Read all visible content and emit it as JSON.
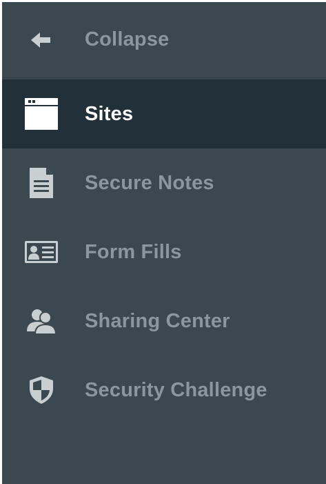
{
  "sidebar": {
    "collapse": {
      "label": "Collapse",
      "icon": "arrow-left-icon"
    },
    "items": [
      {
        "label": "Sites",
        "icon": "browser-window-icon",
        "active": true
      },
      {
        "label": "Secure Notes",
        "icon": "document-icon",
        "active": false
      },
      {
        "label": "Form Fills",
        "icon": "id-card-icon",
        "active": false
      },
      {
        "label": "Sharing Center",
        "icon": "users-icon",
        "active": false
      },
      {
        "label": "Security Challenge",
        "icon": "shield-icon",
        "active": false
      }
    ]
  },
  "colors": {
    "sidebar_bg": "#3c4850",
    "active_bg": "#22303a",
    "label_inactive": "#8b969d",
    "label_active": "#ffffff",
    "icon_inactive": "#c9ced1",
    "icon_active": "#ffffff"
  }
}
